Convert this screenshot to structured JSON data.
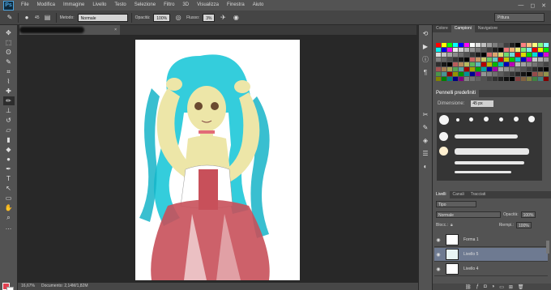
{
  "app": {
    "logo_text": "Ps",
    "menu": [
      "File",
      "Modifica",
      "Immagine",
      "Livello",
      "Testo",
      "Selezione",
      "Filtro",
      "3D",
      "Visualizza",
      "Finestra",
      "Aiuto"
    ],
    "window_controls": [
      "—",
      "◻",
      "✕"
    ]
  },
  "options_bar": {
    "brush_size": "45",
    "mode_label": "Metodo:",
    "mode_value": "Normale",
    "opacity_label": "Opacità:",
    "opacity_value": "100%",
    "flow_label": "Flusso:",
    "flow_value": "3%",
    "workspace": "Pittura"
  },
  "document": {
    "tab_close": "×",
    "status_zoom": "16,67%",
    "status_doc": "Documento: 2,14M/1,82M"
  },
  "tools": [
    {
      "name": "move-tool",
      "glyph": "✥"
    },
    {
      "name": "marquee-tool",
      "glyph": "⬚"
    },
    {
      "name": "lasso-tool",
      "glyph": "ʘ"
    },
    {
      "name": "quick-select-tool",
      "glyph": "✎"
    },
    {
      "name": "crop-tool",
      "glyph": "⌗"
    },
    {
      "name": "eyedropper-tool",
      "glyph": "⌇"
    },
    {
      "name": "healing-tool",
      "glyph": "✚"
    },
    {
      "name": "brush-tool",
      "glyph": "✏"
    },
    {
      "name": "clone-stamp-tool",
      "glyph": "⊥"
    },
    {
      "name": "history-brush-tool",
      "glyph": "↺"
    },
    {
      "name": "eraser-tool",
      "glyph": "▱"
    },
    {
      "name": "gradient-tool",
      "glyph": "▮"
    },
    {
      "name": "blur-tool",
      "glyph": "◆"
    },
    {
      "name": "dodge-tool",
      "glyph": "●"
    },
    {
      "name": "pen-tool",
      "glyph": "✒"
    },
    {
      "name": "type-tool",
      "glyph": "T"
    },
    {
      "name": "path-select-tool",
      "glyph": "↖"
    },
    {
      "name": "shape-tool",
      "glyph": "▭"
    },
    {
      "name": "hand-tool",
      "glyph": "✋"
    },
    {
      "name": "zoom-tool",
      "glyph": "⌕"
    },
    {
      "name": "more-tools",
      "glyph": "…"
    }
  ],
  "color_panel": {
    "tabs": [
      "Colore",
      "Campioni",
      "Navigatore"
    ],
    "active_tab": "Campioni"
  },
  "brush_presets": {
    "title": "Pennelli predefiniti",
    "dimension_label": "Dimensione:",
    "dimension_value": "45 px"
  },
  "layers_panel": {
    "tabs": [
      "Livelli",
      "Canali",
      "Tracciati"
    ],
    "filter_value": "Tipo",
    "blend_value": "Normale",
    "opacity_label": "Opacità:",
    "opacity_value": "100%",
    "lock_label": "Blocc.:",
    "fill_label": "Riempi.:",
    "fill_value": "100%",
    "layers": [
      {
        "name": "Forma 1",
        "selected": false
      },
      {
        "name": "Livello 5",
        "selected": true
      },
      {
        "name": "Livello 4",
        "selected": false
      }
    ]
  },
  "colors": {
    "menubar": "#535353",
    "panel": "#535353",
    "selection": "#6e7a91",
    "hair": "#1ec8d8",
    "dress": "#c8505a",
    "skin": "#ede6a8"
  }
}
